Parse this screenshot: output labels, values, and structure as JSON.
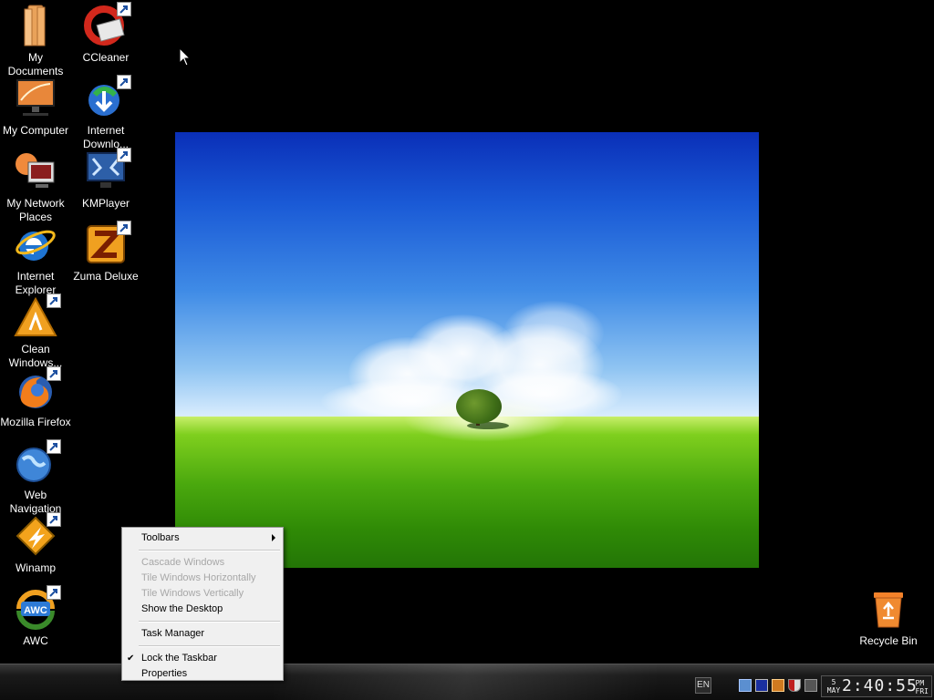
{
  "desktop_icons": [
    {
      "id": "my-documents",
      "label": "My Documents",
      "shortcut": false
    },
    {
      "id": "ccleaner",
      "label": "CCleaner",
      "shortcut": true
    },
    {
      "id": "my-computer",
      "label": "My Computer",
      "shortcut": false
    },
    {
      "id": "internet-download",
      "label": "Internet Downlo...",
      "shortcut": true
    },
    {
      "id": "my-network-places",
      "label": "My Network Places",
      "shortcut": false
    },
    {
      "id": "kmplayer",
      "label": "KMPlayer",
      "shortcut": true
    },
    {
      "id": "internet-explorer",
      "label": "Internet Explorer",
      "shortcut": false
    },
    {
      "id": "zuma-deluxe",
      "label": "Zuma Deluxe",
      "shortcut": true
    },
    {
      "id": "clean-windows",
      "label": "Clean Windows...",
      "shortcut": true
    },
    {
      "id": "mozilla-firefox",
      "label": "Mozilla Firefox",
      "shortcut": true
    },
    {
      "id": "web-navigation",
      "label": "Web Navigation",
      "shortcut": true
    },
    {
      "id": "winamp",
      "label": "Winamp",
      "shortcut": true
    },
    {
      "id": "awc",
      "label": "AWC",
      "shortcut": true
    },
    {
      "id": "recycle-bin",
      "label": "Recycle Bin",
      "shortcut": false
    }
  ],
  "context_menu": {
    "toolbars": "Toolbars",
    "cascade": "Cascade Windows",
    "tile_h": "Tile Windows Horizontally",
    "tile_v": "Tile Windows Vertically",
    "show_desktop": "Show the Desktop",
    "task_manager": "Task Manager",
    "lock_taskbar": "Lock the Taskbar",
    "properties": "Properties"
  },
  "taskbar": {
    "language": "EN",
    "clock": {
      "day": "5",
      "month": "MAY",
      "time": "2:40:55",
      "ampm": "PM",
      "weekday": "FRI"
    }
  },
  "colors": {
    "desktop_bg": "#000000",
    "menu_bg": "#f0f0f0",
    "menu_disabled": "#a7a7a7"
  }
}
